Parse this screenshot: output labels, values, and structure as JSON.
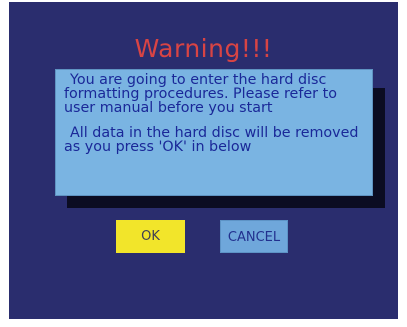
{
  "header": {
    "clipped_text": "",
    "title": "Warning!!!"
  },
  "dialog": {
    "paragraph_1": "You are going to enter the hard disc formatting procedures. Please refer to user manual before you start",
    "paragraph_2": "All data in the hard disc will be removed as you press 'OK' in below"
  },
  "buttons": {
    "ok_label": "OK",
    "cancel_label": "CANCEL"
  },
  "colors": {
    "screen_background": "#2a2d6e",
    "title": "#d84444",
    "dialog_background": "#7ab4e2",
    "dialog_text": "#1a2898",
    "ok_button": "#f2e52a",
    "cancel_button": "#6fa7db"
  }
}
